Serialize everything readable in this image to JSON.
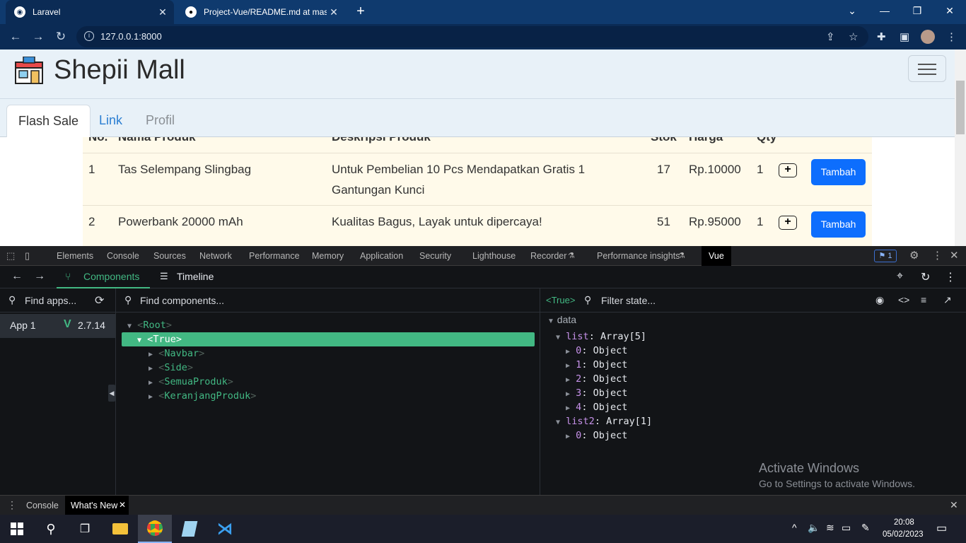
{
  "browser": {
    "tabs": [
      {
        "title": "Laravel"
      },
      {
        "title": "Project-Vue/README.md at mast"
      }
    ],
    "url": "127.0.0.1:8000"
  },
  "site": {
    "brand": "Shepii Mall",
    "tabs": [
      "Flash Sale",
      "Link",
      "Profil"
    ],
    "table": {
      "headers": [
        "No.",
        "Nama Produk",
        "Deskripsi Produk",
        "Stok",
        "Harga",
        "Qty"
      ],
      "rows": [
        {
          "no": "1",
          "name": "Tas Selempang Slingbag",
          "desc1": "Untuk Pembelian 10 Pcs Mendapatkan Gratis 1",
          "desc2": "Gantungan Kunci",
          "stock": "17",
          "price": "Rp.10000",
          "qty": "1",
          "button": "Tambah"
        },
        {
          "no": "2",
          "name": "Powerbank 20000 mAh",
          "desc1": "Kualitas Bagus, Layak untuk dipercaya!",
          "desc2": "",
          "stock": "51",
          "price": "Rp.95000",
          "qty": "1",
          "button": "Tambah"
        }
      ]
    }
  },
  "devtools": {
    "tabs": [
      "Elements",
      "Console",
      "Sources",
      "Network",
      "Performance",
      "Memory",
      "Application",
      "Security",
      "Lighthouse",
      "Recorder",
      "Performance insights",
      "Vue"
    ],
    "issues_count": "1",
    "vue": {
      "components_label": "Components",
      "timeline_label": "Timeline",
      "find_apps": "Find apps...",
      "app_name": "App 1",
      "vue_version": "2.7.14",
      "find_components": "Find components...",
      "tree": [
        {
          "name": "Root",
          "level": 0
        },
        {
          "name": "True",
          "level": 1
        },
        {
          "name": "Navbar",
          "level": 2
        },
        {
          "name": "Side",
          "level": 2
        },
        {
          "name": "SemuaProduk",
          "level": 2
        },
        {
          "name": "KeranjangProduk",
          "level": 2
        }
      ],
      "selected_component": "<True>",
      "filter_state": "Filter state...",
      "data_label": "data",
      "state": [
        {
          "key": "list",
          "value": "Array[5]",
          "expanded": true,
          "depth": 0
        },
        {
          "key": "0",
          "value": "Object",
          "depth": 1
        },
        {
          "key": "1",
          "value": "Object",
          "depth": 1
        },
        {
          "key": "2",
          "value": "Object",
          "depth": 1
        },
        {
          "key": "3",
          "value": "Object",
          "depth": 1
        },
        {
          "key": "4",
          "value": "Object",
          "depth": 1
        },
        {
          "key": "list2",
          "value": "Array[1]",
          "expanded": true,
          "depth": 0
        },
        {
          "key": "0",
          "value": "Object",
          "depth": 1
        }
      ]
    },
    "drawer_tabs": [
      "Console",
      "What's New"
    ]
  },
  "watermark": {
    "line1": "Activate Windows",
    "line2": "Go to Settings to activate Windows."
  },
  "taskbar": {
    "time": "20:08",
    "date": "05/02/2023"
  },
  "colors": {
    "vue_green": "#42b883",
    "button_blue": "#0d6efd",
    "chrome_frame": "#0f3a6e"
  }
}
